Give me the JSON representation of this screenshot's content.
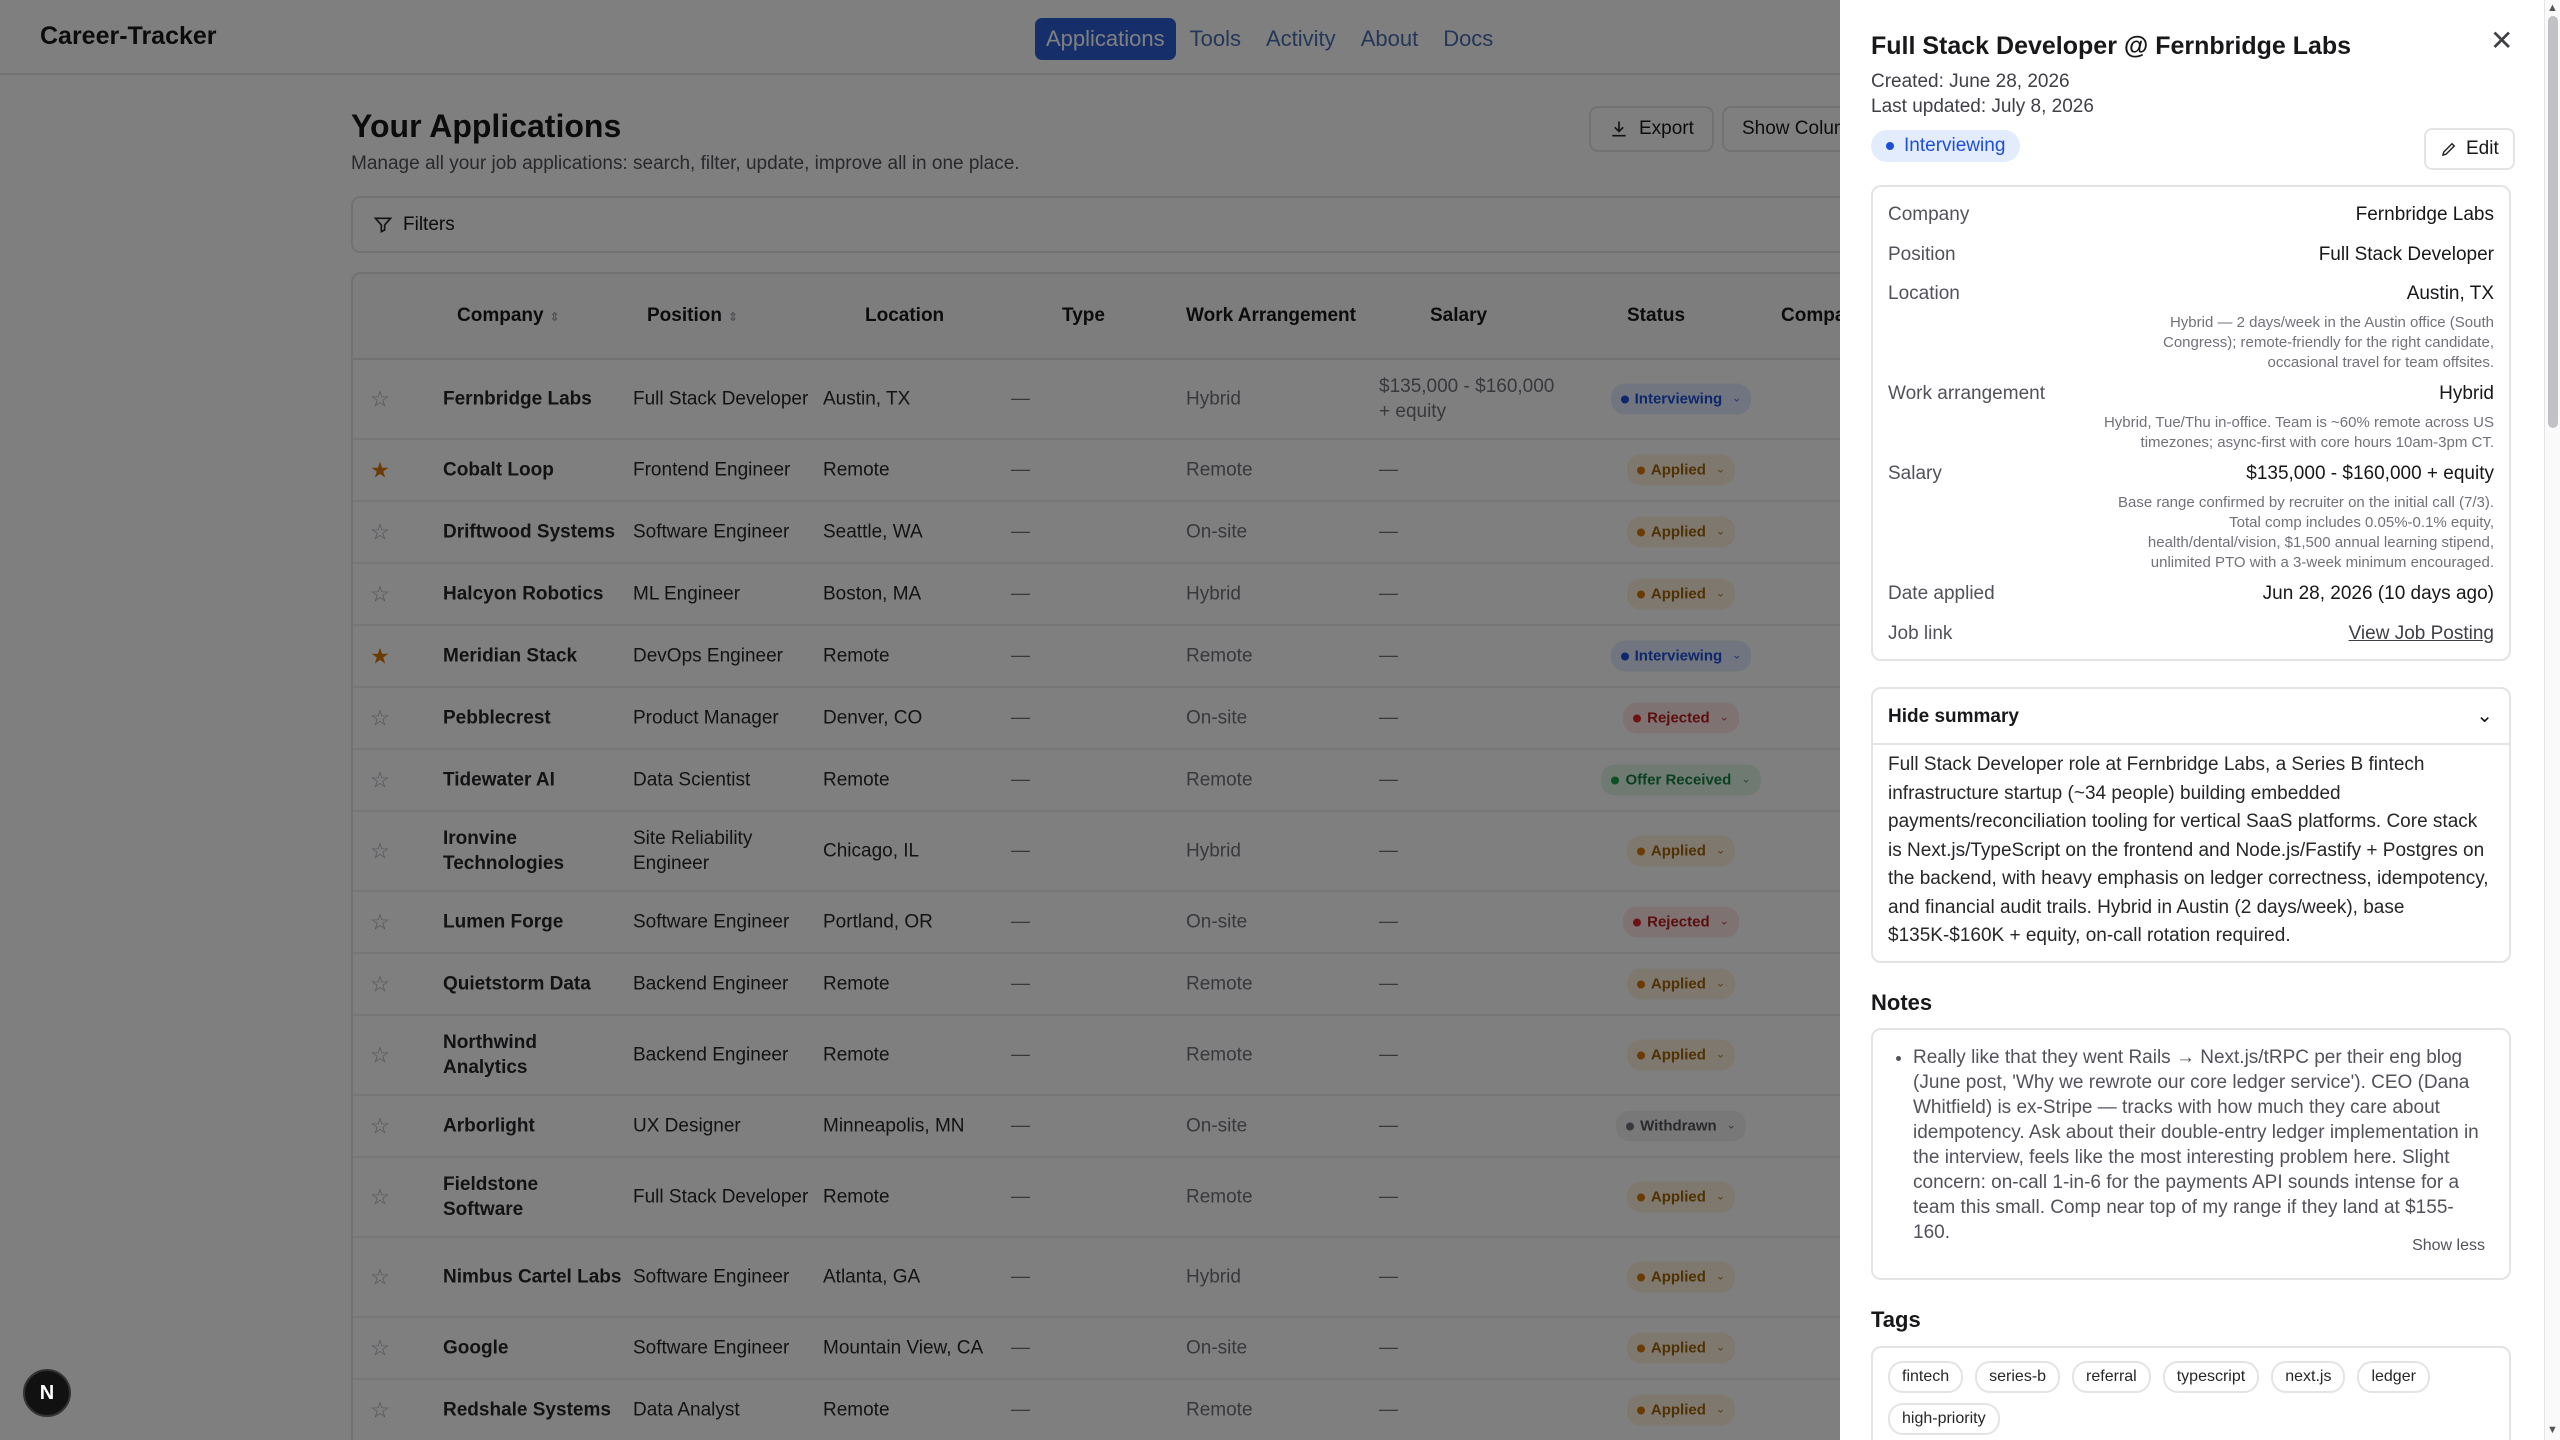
{
  "app": {
    "brand": "Career-Tracker"
  },
  "nav": [
    "Applications",
    "Tools",
    "Activity",
    "About",
    "Docs"
  ],
  "page": {
    "title": "Your Applications",
    "subtitle": "Manage all your job applications: search, filter, update, improve all in one place.",
    "export_label": "Export",
    "columns_label": "Show Columns",
    "filters_label": "Filters"
  },
  "table": {
    "headers": {
      "company": "Company",
      "position": "Position",
      "location": "Location",
      "type": "Type",
      "arrangement": "Work Arrangement",
      "salary": "Salary",
      "status": "Status",
      "compatibility": "Compatibility"
    },
    "rows": [
      {
        "starred": false,
        "company": "Fernbridge Labs",
        "position": "Full Stack Developer",
        "location": "Austin, TX",
        "type": "—",
        "arrangement": "Hybrid",
        "salary": "$135,000 - $160,000 + equity",
        "status": "Interviewing",
        "status_key": "interviewing"
      },
      {
        "starred": true,
        "company": "Cobalt Loop",
        "position": "Frontend Engineer",
        "location": "Remote",
        "type": "—",
        "arrangement": "Remote",
        "salary": "—",
        "status": "Applied",
        "status_key": "applied"
      },
      {
        "starred": false,
        "company": "Driftwood Systems",
        "position": "Software Engineer",
        "location": "Seattle, WA",
        "type": "—",
        "arrangement": "On-site",
        "salary": "—",
        "status": "Applied",
        "status_key": "applied"
      },
      {
        "starred": false,
        "company": "Halcyon Robotics",
        "position": "ML Engineer",
        "location": "Boston, MA",
        "type": "—",
        "arrangement": "Hybrid",
        "salary": "—",
        "status": "Applied",
        "status_key": "applied"
      },
      {
        "starred": true,
        "company": "Meridian Stack",
        "position": "DevOps Engineer",
        "location": "Remote",
        "type": "—",
        "arrangement": "Remote",
        "salary": "—",
        "status": "Interviewing",
        "status_key": "interviewing"
      },
      {
        "starred": false,
        "company": "Pebblecrest",
        "position": "Product Manager",
        "location": "Denver, CO",
        "type": "—",
        "arrangement": "On-site",
        "salary": "—",
        "status": "Rejected",
        "status_key": "rejected"
      },
      {
        "starred": false,
        "company": "Tidewater AI",
        "position": "Data Scientist",
        "location": "Remote",
        "type": "—",
        "arrangement": "Remote",
        "salary": "—",
        "status": "Offer Received",
        "status_key": "offer"
      },
      {
        "starred": false,
        "company": "Ironvine Technologies",
        "position": "Site Reliability Engineer",
        "location": "Chicago, IL",
        "type": "—",
        "arrangement": "Hybrid",
        "salary": "—",
        "status": "Applied",
        "status_key": "applied"
      },
      {
        "starred": false,
        "company": "Lumen Forge",
        "position": "Software Engineer",
        "location": "Portland, OR",
        "type": "—",
        "arrangement": "On-site",
        "salary": "—",
        "status": "Rejected",
        "status_key": "rejected"
      },
      {
        "starred": false,
        "company": "Quietstorm Data",
        "position": "Backend Engineer",
        "location": "Remote",
        "type": "—",
        "arrangement": "Remote",
        "salary": "—",
        "status": "Applied",
        "status_key": "applied"
      },
      {
        "starred": false,
        "company": "Northwind Analytics",
        "position": "Backend Engineer",
        "location": "Remote",
        "type": "—",
        "arrangement": "Remote",
        "salary": "—",
        "status": "Applied",
        "status_key": "applied"
      },
      {
        "starred": false,
        "company": "Arborlight",
        "position": "UX Designer",
        "location": "Minneapolis, MN",
        "type": "—",
        "arrangement": "On-site",
        "salary": "—",
        "status": "Withdrawn",
        "status_key": "withdrawn"
      },
      {
        "starred": false,
        "company": "Fieldstone Software",
        "position": "Full Stack Developer",
        "location": "Remote",
        "type": "—",
        "arrangement": "Remote",
        "salary": "—",
        "status": "Applied",
        "status_key": "applied"
      },
      {
        "starred": false,
        "company": "Nimbus Cartel Labs",
        "position": "Software Engineer",
        "location": "Atlanta, GA",
        "type": "—",
        "arrangement": "Hybrid",
        "salary": "—",
        "status": "Applied",
        "status_key": "applied"
      },
      {
        "starred": false,
        "company": "Google",
        "position": "Software Engineer",
        "location": "Mountain View, CA",
        "type": "—",
        "arrangement": "On-site",
        "salary": "—",
        "status": "Applied",
        "status_key": "applied"
      },
      {
        "starred": false,
        "company": "Redshale Systems",
        "position": "Data Analyst",
        "location": "Remote",
        "type": "—",
        "arrangement": "Remote",
        "salary": "—",
        "status": "Applied",
        "status_key": "applied"
      }
    ]
  },
  "panel": {
    "title": "Full Stack Developer @ Fernbridge Labs",
    "created": "Created: June 28, 2026",
    "updated": "Last updated: July 8, 2026",
    "status": "Interviewing",
    "edit_label": "Edit",
    "details": {
      "company_label": "Company",
      "company": "Fernbridge Labs",
      "position_label": "Position",
      "position": "Full Stack Developer",
      "location_label": "Location",
      "location": "Austin, TX",
      "location_note_1": "Hybrid — 2 days/week in the Austin office (South",
      "location_note_2": "Congress); remote-friendly for the right candidate,",
      "location_note_3": "occasional travel for team offsites.",
      "arrangement_label": "Work arrangement",
      "arrangement": "Hybrid",
      "arrangement_note_1": "Hybrid, Tue/Thu in-office. Team is ~60% remote across US",
      "arrangement_note_2": "timezones; async-first with core hours 10am-3pm CT.",
      "salary_label": "Salary",
      "salary": "$135,000 - $160,000 + equity",
      "salary_note_1": "Base range confirmed by recruiter on the initial call (7/3).",
      "salary_note_2": "Total comp includes 0.05%-0.1% equity,",
      "salary_note_3": "health/dental/vision, $1,500 annual learning stipend,",
      "salary_note_4": "unlimited PTO with a 3-week minimum encouraged.",
      "date_label": "Date applied",
      "date": "Jun 28, 2026 (10 days ago)",
      "link_label": "Job link",
      "link": "View Job Posting"
    },
    "summary_toggle": "Hide summary",
    "summary": "Full Stack Developer role at Fernbridge Labs, a Series B fintech infrastructure startup (~34 people) building embedded payments/reconciliation tooling for vertical SaaS platforms. Core stack is Next.js/TypeScript on the frontend and Node.js/Fastify + Postgres on the backend, with heavy emphasis on ledger correctness, idempotency, and financial audit trails. Hybrid in Austin (2 days/week), base $135K-$160K + equity, on-call rotation required.",
    "notes_title": "Notes",
    "note": "Really like that they went Rails → Next.js/tRPC per their eng blog (June post, 'Why we rewrote our core ledger service'). CEO (Dana Whitfield) is ex-Stripe — tracks with how much they care about idempotency. Ask about their double-entry ledger implementation in the interview, feels like the most interesting problem here. Slight concern: on-call 1-in-6 for the payments API sounds intense for a team this small. Comp near top of my range if they land at $155-160.",
    "show_less": "Show less",
    "tags_title": "Tags",
    "tags": [
      "fintech",
      "series-b",
      "referral",
      "typescript",
      "next.js",
      "ledger",
      "high-priority"
    ]
  },
  "fab_label": "N"
}
